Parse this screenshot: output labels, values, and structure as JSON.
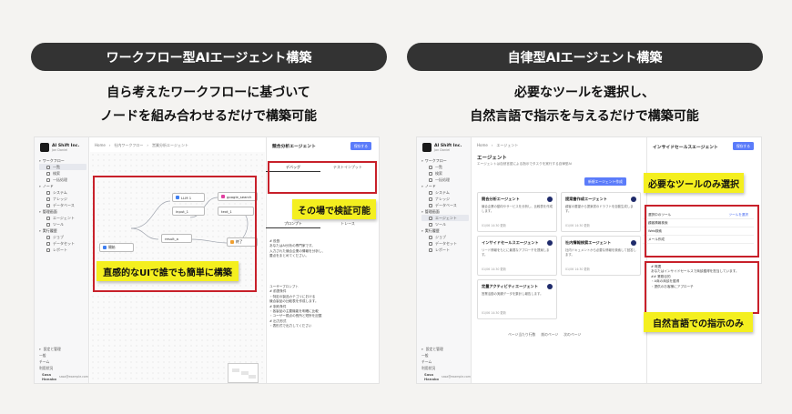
{
  "left": {
    "title": "ワークフロー型AIエージェント構築",
    "desc_line1": "自ら考えたワークフローに基づいて",
    "desc_line2": "ノードを組み合わせるだけで構築可能",
    "callout_main": "直感的なUIで誰でも簡単に構築",
    "callout_panel": "その場で検証可能",
    "sidebar": {
      "org_name": "AI Shift Inc.",
      "org_sub": "Jan Daniel",
      "section_workflow": "ワークフロー",
      "items_workflow": [
        "一覧",
        "検索",
        "一括処理"
      ],
      "section_node": "ノード",
      "items_node": [
        "システム",
        "ナレッジ",
        "データベース"
      ],
      "section_manage": "管理画面",
      "items_manage": [
        "エージェント",
        "ツール"
      ],
      "section_run": "実行履歴",
      "items_run": [
        "ジョブ",
        "データセット",
        "レポート"
      ],
      "foot": [
        "設定と管理",
        "一般",
        "チーム",
        "利用状況"
      ],
      "user_name": "Sasa Hanako",
      "user_mail": "sasa@example.com"
    },
    "crumbs": [
      "Home",
      "社内ワークフロー",
      "営業分析エージェント"
    ],
    "nodes": [
      "開始",
      "LLM 1",
      "input_1",
      "google_search",
      "result_a",
      "終了",
      "text_1"
    ],
    "panel": {
      "title": "競合分析エージェント",
      "button": "保存する",
      "tab_debug": "デバッグ",
      "tab_input": "テストインプット",
      "tab_prompt": "プロンプト",
      "tab_trace": "トレース",
      "text1": "# 役割\nあなたはAI分析の専門家です。\n入力された競合企業の情報を分析し、\n要点をまとめてください。",
      "text2": "ユーザープロンプト\n# 前提条件\n・特定の製品カテゴリにおける\n  競合製品の比較表を作成します。\n# 制約条件\n・各製品の主要機能を明確に比較\n・ユーザー視点の長所と短所を記載\n# 出力形式\n・表形式で出力してください"
    }
  },
  "right": {
    "title": "自律型AIエージェント構築",
    "desc_line1": "必要なツールを選択し、",
    "desc_line2": "自然言語で指示を与えるだけで構築可能",
    "callout_tools": "必要なツールのみ選択",
    "callout_nl": "自然言語での指示のみ",
    "list_title": "エージェント",
    "list_sub": "エージェントは自然言語による指示でタスクを実行する自律型AI",
    "new_button": "新規エージェント作成",
    "cards": [
      {
        "title": "競合分析エージェント",
        "body": "競合企業の動向やサービスを分析し、比較表を作成します。",
        "date": "01/06 14:30 更新"
      },
      {
        "title": "提案書作成エージェント",
        "body": "顧客の要望から提案書のドラフトを自動生成します。",
        "date": "01/06 14:30 更新"
      },
      {
        "title": "インサイドセールスエージェント",
        "body": "リード情報をもとに最適なアプローチを提案します。",
        "date": "01/06 14:30 更新"
      },
      {
        "title": "社内情報検索エージェント",
        "body": "社内ドキュメントから必要な情報を検索して回答します。",
        "date": "01/06 14:30 更新"
      },
      {
        "title": "定量アクティビティエージェント",
        "body": "営業活動の実績データを集計し報告します。",
        "date": "01/06 14:30 更新"
      }
    ],
    "pager_per": "ページ当たり行数",
    "pager_prev": "前のページ",
    "pager_next": "次のページ",
    "panel_title": "インサイドセールスエージェント",
    "panel_button": "保存する",
    "tools_label": "選択中のツール",
    "tools_link": "ツールを選択",
    "tools": [
      "顧客情報検索",
      "Web検索",
      "メール作成"
    ],
    "instruction": "# 概要\nあなたはインサイドセールスで商談獲得を担当しています。\n## 業務目的\n・A商の商談を獲得\n・提供のお客様にアプローチ"
  }
}
